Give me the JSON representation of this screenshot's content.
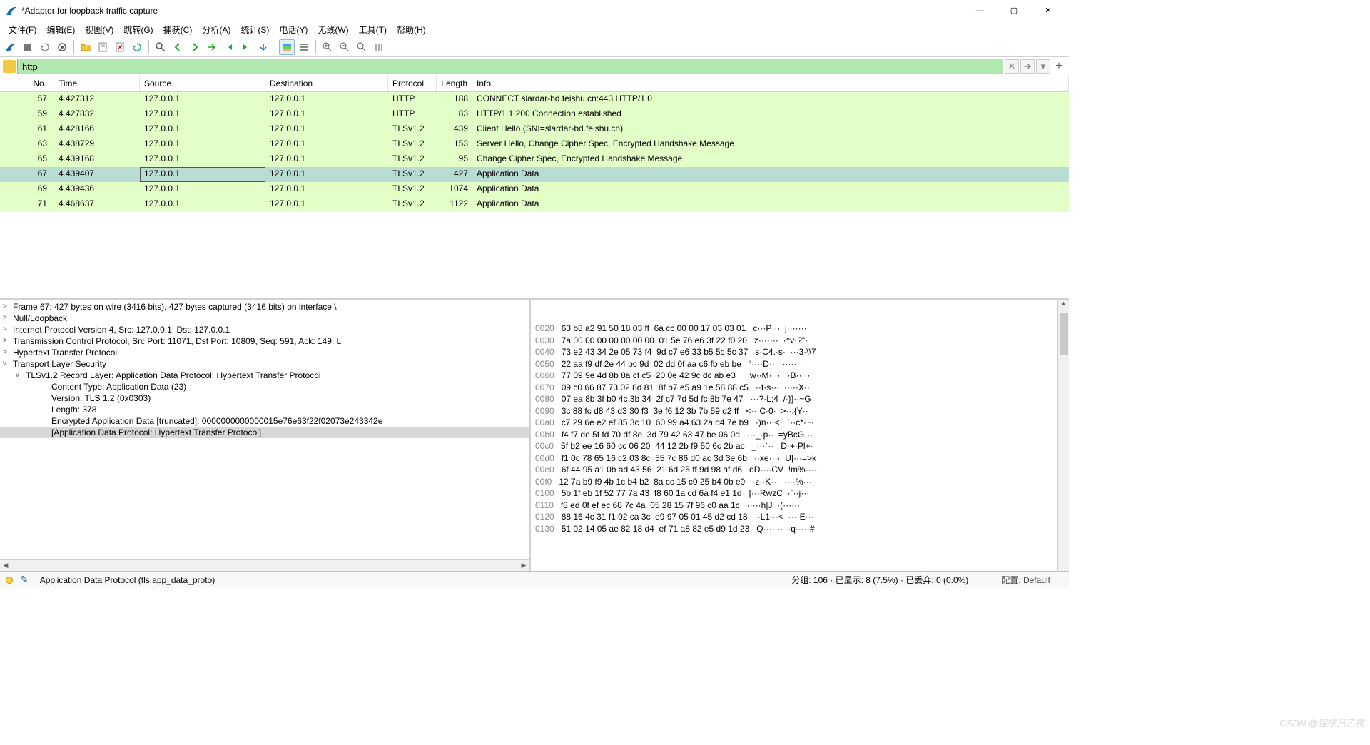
{
  "window": {
    "title": "*Adapter for loopback traffic capture"
  },
  "winbtns": {
    "min": "—",
    "max": "▢",
    "close": "✕"
  },
  "menu": {
    "file": "文件(F)",
    "edit": "编辑(E)",
    "view": "视图(V)",
    "go": "跳转(G)",
    "capture": "捕获(C)",
    "analyze": "分析(A)",
    "stats": "统计(S)",
    "telephony": "电话(Y)",
    "wireless": "无线(W)",
    "tools": "工具(T)",
    "help": "帮助(H)"
  },
  "filter": {
    "value": "http",
    "clear": "✕",
    "arrow": "➜",
    "dd": "▾",
    "plus": "+"
  },
  "columns": {
    "no": "No.",
    "time": "Time",
    "source": "Source",
    "destination": "Destination",
    "protocol": "Protocol",
    "length": "Length",
    "info": "Info"
  },
  "packets": [
    {
      "no": "57",
      "time": "4.427312",
      "src": "127.0.0.1",
      "dst": "127.0.0.1",
      "proto": "HTTP",
      "len": "188",
      "info": "CONNECT slardar-bd.feishu.cn:443 HTTP/1.0",
      "sel": false
    },
    {
      "no": "59",
      "time": "4.427832",
      "src": "127.0.0.1",
      "dst": "127.0.0.1",
      "proto": "HTTP",
      "len": "83",
      "info": "HTTP/1.1 200 Connection established",
      "sel": false
    },
    {
      "no": "61",
      "time": "4.428166",
      "src": "127.0.0.1",
      "dst": "127.0.0.1",
      "proto": "TLSv1.2",
      "len": "439",
      "info": "Client Hello (SNI=slardar-bd.feishu.cn)",
      "sel": false
    },
    {
      "no": "63",
      "time": "4.438729",
      "src": "127.0.0.1",
      "dst": "127.0.0.1",
      "proto": "TLSv1.2",
      "len": "153",
      "info": "Server Hello, Change Cipher Spec, Encrypted Handshake Message",
      "sel": false
    },
    {
      "no": "65",
      "time": "4.439168",
      "src": "127.0.0.1",
      "dst": "127.0.0.1",
      "proto": "TLSv1.2",
      "len": "95",
      "info": "Change Cipher Spec, Encrypted Handshake Message",
      "sel": false
    },
    {
      "no": "67",
      "time": "4.439407",
      "src": "127.0.0.1",
      "dst": "127.0.0.1",
      "proto": "TLSv1.2",
      "len": "427",
      "info": "Application Data",
      "sel": true
    },
    {
      "no": "69",
      "time": "4.439436",
      "src": "127.0.0.1",
      "dst": "127.0.0.1",
      "proto": "TLSv1.2",
      "len": "1074",
      "info": "Application Data",
      "sel": false
    },
    {
      "no": "71",
      "time": "4.468637",
      "src": "127.0.0.1",
      "dst": "127.0.0.1",
      "proto": "TLSv1.2",
      "len": "1122",
      "info": "Application Data",
      "sel": false
    }
  ],
  "tree": [
    {
      "tw": ">",
      "ind": 0,
      "text": "Frame 67: 427 bytes on wire (3416 bits), 427 bytes captured (3416 bits) on interface \\"
    },
    {
      "tw": ">",
      "ind": 0,
      "text": "Null/Loopback"
    },
    {
      "tw": ">",
      "ind": 0,
      "text": "Internet Protocol Version 4, Src: 127.0.0.1, Dst: 127.0.0.1"
    },
    {
      "tw": ">",
      "ind": 0,
      "text": "Transmission Control Protocol, Src Port: 11071, Dst Port: 10809, Seq: 591, Ack: 149, L"
    },
    {
      "tw": ">",
      "ind": 0,
      "text": "Hypertext Transfer Protocol"
    },
    {
      "tw": "v",
      "ind": 0,
      "text": "Transport Layer Security"
    },
    {
      "tw": "v",
      "ind": 1,
      "text": "TLSv1.2 Record Layer: Application Data Protocol: Hypertext Transfer Protocol"
    },
    {
      "tw": "",
      "ind": 2,
      "text": "Content Type: Application Data (23)"
    },
    {
      "tw": "",
      "ind": 2,
      "text": "Version: TLS 1.2 (0x0303)"
    },
    {
      "tw": "",
      "ind": 2,
      "text": "Length: 378"
    },
    {
      "tw": "",
      "ind": 2,
      "text": "Encrypted Application Data [truncated]: 0000000000000015e76e63f22f02073e243342e"
    },
    {
      "tw": "",
      "ind": 2,
      "text": "[Application Data Protocol: Hypertext Transfer Protocol]",
      "hl": true
    }
  ],
  "hex": [
    {
      "off": "0020",
      "b": "63 b8 a2 91 50 18 03 ff  6a cc 00 00 17 03 03 01",
      "a": "c···P···  j·······"
    },
    {
      "off": "0030",
      "b": "7a 00 00 00 00 00 00 00  01 5e 76 e6 3f 22 f0 20",
      "a": "z·······  ·^v·?\"· "
    },
    {
      "off": "0040",
      "b": "73 e2 43 34 2e 05 73 f4  9d c7 e6 33 b5 5c 5c 37",
      "a": "s·C4.·s·  ···3·\\\\7"
    },
    {
      "off": "0050",
      "b": "22 aa f9 df 2e 44 bc 9d  02 dd 0f aa c6 fb eb be",
      "a": "\"····D··  ········"
    },
    {
      "off": "0060",
      "b": "77 09 9e 4d 8b 8a cf c5  20 0e 42 9c dc ab e3",
      "a": "w··M····   ·B·····"
    },
    {
      "off": "0070",
      "b": "09 c0 66 87 73 02 8d 81  8f b7 e5 a9 1e 58 88 c5",
      "a": "··f·s···  ·····X··"
    },
    {
      "off": "0080",
      "b": "07 ea 8b 3f b0 4c 3b 34  2f c7 7d 5d fc 8b 7e 47",
      "a": "···?·L;4  /·}]··~G"
    },
    {
      "off": "0090",
      "b": "3c 88 fc d8 43 d3 30 f3  3e f6 12 3b 7b 59 d2 ff",
      "a": "<···C·0·  >··;{Y··"
    },
    {
      "off": "00a0",
      "b": "c7 29 6e e2 ef 85 3c 10  60 99 a4 63 2a d4 7e b9",
      "a": "·)n···<·  `··c*·~·"
    },
    {
      "off": "00b0",
      "b": "f4 f7 de 5f fd 70 df 8e  3d 79 42 63 47 be 06 0d",
      "a": "···_·p··  =yBcG···"
    },
    {
      "off": "00c0",
      "b": "5f b2 ee 16 60 cc 06 20  44 12 2b f9 50 6c 2b ac",
      "a": "_···`··   D·+·Pl+·"
    },
    {
      "off": "00d0",
      "b": "f1 0c 78 65 16 c2 03 8c  55 7c 86 d0 ac 3d 3e 6b",
      "a": "··xe····  U|···=>k"
    },
    {
      "off": "00e0",
      "b": "6f 44 95 a1 0b ad 43 56  21 6d 25 ff 9d 98 af d6",
      "a": "oD····CV  !m%·····"
    },
    {
      "off": "00f0",
      "b": "12 7a b9 f9 4b 1c b4 b2  8a cc 15 c0 25 b4 0b e0",
      "a": "·z··K···  ····%···"
    },
    {
      "off": "0100",
      "b": "5b 1f eb 1f 52 77 7a 43  f8 60 1a cd 6a f4 e1 1d",
      "a": "[···RwzC  ·`··j···"
    },
    {
      "off": "0110",
      "b": "f8 ed 0f ef ec 68 7c 4a  05 28 15 7f 96 c0 aa 1c",
      "a": "·····h|J  ·(······"
    },
    {
      "off": "0120",
      "b": "88 16 4c 31 f1 02 ca 3c  e9 97 05 01 45 d2 cd 18",
      "a": "··L1···<  ····E···"
    },
    {
      "off": "0130",
      "b": "51 02 14 05 ae 82 18 d4  ef 71 a8 82 e5 d9 1d 23",
      "a": "Q·······  ·q·····#"
    }
  ],
  "status": {
    "left": "Application Data Protocol (tls.app_data_proto)",
    "mid": "分组: 106 · 已显示: 8 (7.5%) · 已丢弃: 0 (0.0%)",
    "right": "配置: Default"
  },
  "watermark": "CSDN @程序员乙夜"
}
